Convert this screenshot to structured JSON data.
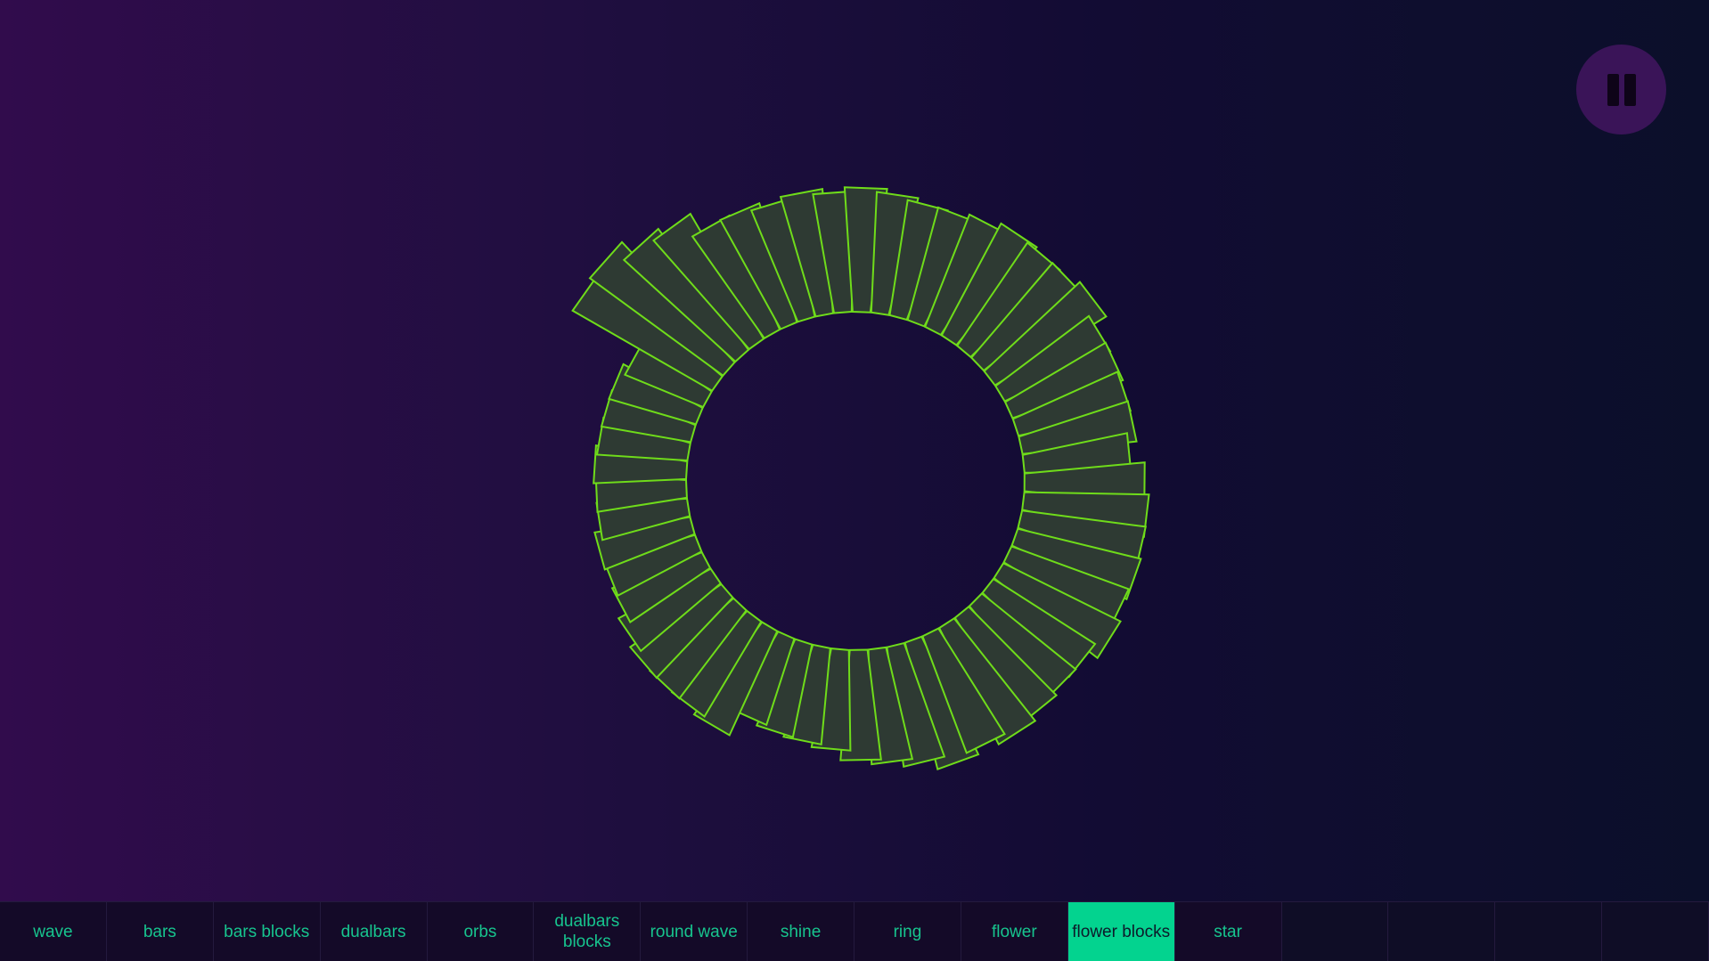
{
  "visualizer": {
    "petal_fill": "#2e3a33",
    "petal_stroke": "#6fdc1a",
    "petal_lengths": [
      0.65,
      0.6,
      0.57,
      0.55,
      0.5,
      0.48,
      0.47,
      0.45,
      0.57,
      0.55,
      0.55,
      0.55,
      0.52,
      0.48,
      0.47,
      0.48,
      0.45,
      0.45,
      0.46,
      0.45,
      0.45,
      0.45,
      0.42,
      0.8,
      0.82,
      0.75,
      0.72,
      0.62,
      0.62,
      0.6,
      0.62,
      0.6,
      0.62,
      0.6,
      0.58,
      0.58,
      0.6,
      0.63,
      0.62,
      0.62,
      0.65,
      0.58,
      0.58,
      0.57,
      0.57,
      0.53,
      0.6,
      0.62,
      0.62,
      0.63,
      0.62,
      0.65,
      0.6,
      0.6,
      0.62,
      0.65,
      0.62
    ]
  },
  "controls": {
    "pause_icon": "pause-icon"
  },
  "tabs": [
    {
      "label": "wave",
      "active": false
    },
    {
      "label": "bars",
      "active": false
    },
    {
      "label": "bars blocks",
      "active": false
    },
    {
      "label": "dualbars",
      "active": false
    },
    {
      "label": "orbs",
      "active": false
    },
    {
      "label": "dualbars blocks",
      "active": false
    },
    {
      "label": "round wave",
      "active": false
    },
    {
      "label": "shine",
      "active": false
    },
    {
      "label": "ring",
      "active": false
    },
    {
      "label": "flower",
      "active": false
    },
    {
      "label": "flower blocks",
      "active": true
    },
    {
      "label": "star",
      "active": false
    }
  ],
  "colors": {
    "accent": "#03d38f",
    "tab_text": "#17c48e",
    "pause_button": "#3a1458"
  }
}
